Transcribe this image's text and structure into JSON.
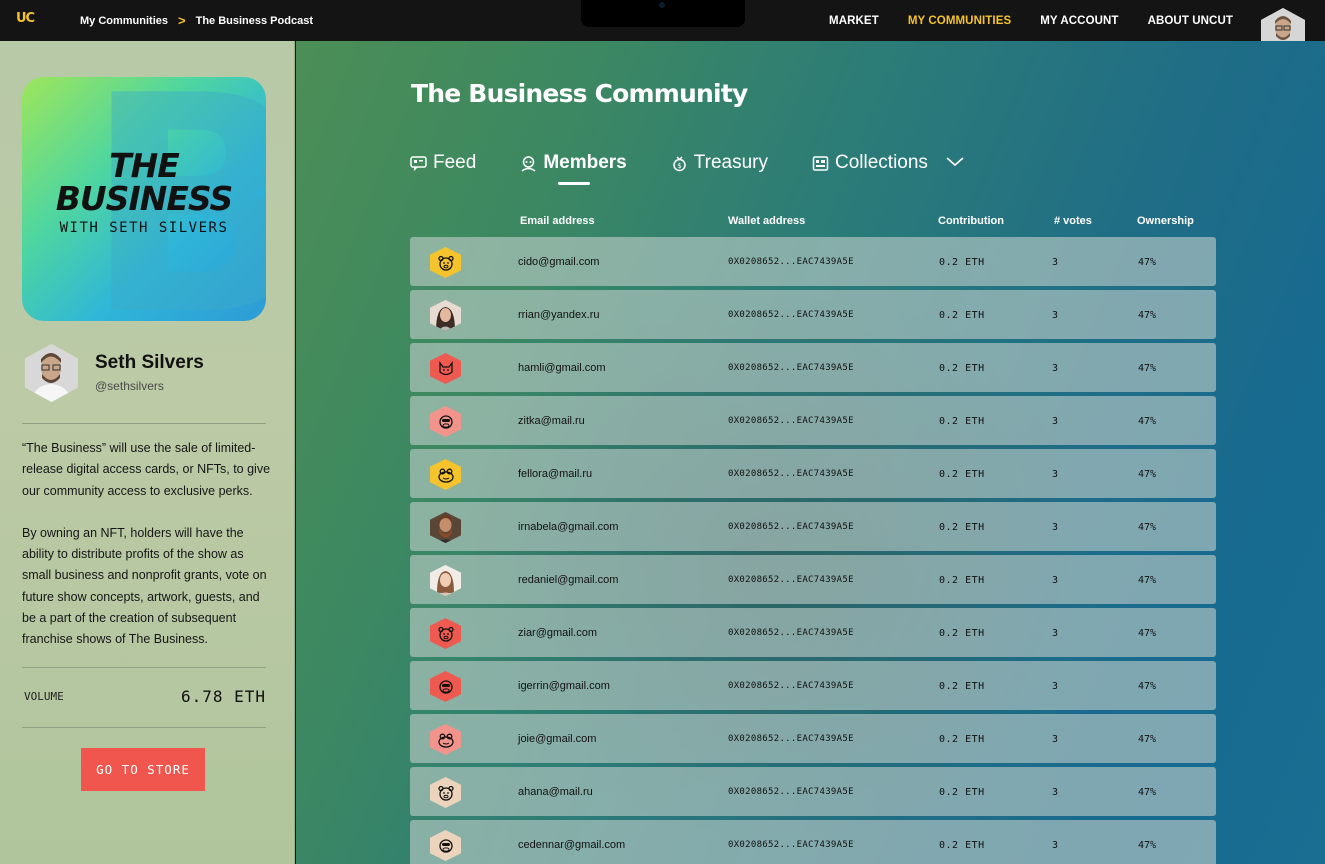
{
  "topbar": {
    "logo": "UC",
    "breadcrumb": [
      "My Communities",
      "The Business Podcast"
    ],
    "breadcrumb_separator": ">",
    "nav": [
      {
        "label": "MARKET",
        "active": false
      },
      {
        "label": "MY COMMUNITIES",
        "active": true
      },
      {
        "label": "MY ACCOUNT",
        "active": false
      },
      {
        "label": "ABOUT UNCUT",
        "active": false
      }
    ],
    "accent_color": "#f5c32c"
  },
  "sidebar": {
    "cover": {
      "line1": "THE",
      "line2": "BUSINESS",
      "line3": "WITH SETH SILVERS",
      "watermark": "B"
    },
    "host": {
      "name": "Seth Silvers",
      "handle": "@sethsilvers"
    },
    "description": [
      "“The Business” will use the sale of limited-release digital access cards, or NFTs, to give our community access to exclusive perks.",
      "By owning an NFT, holders will have the ability to distribute profits of the show as small business and nonprofit grants, vote on future show concepts, artwork, guests, and be a part of the creation of subsequent franchise shows of The Business."
    ],
    "volume_label": "VOLUME",
    "volume_value": "6.78 ETH",
    "store_button": "GO TO STORE",
    "store_button_color": "#f0564d"
  },
  "main": {
    "title": "The Business Community",
    "tabs": [
      {
        "label": "Feed",
        "icon": "feed-icon",
        "active": false
      },
      {
        "label": "Members",
        "icon": "members-icon",
        "active": true
      },
      {
        "label": "Treasury",
        "icon": "treasury-icon",
        "active": false
      },
      {
        "label": "Collections",
        "icon": "collections-icon",
        "active": false
      }
    ],
    "columns": [
      "Email address",
      "Wallet address",
      "Contribution",
      "# votes",
      "Ownership"
    ],
    "members": [
      {
        "email": "cido@gmail.com",
        "wallet": "0X0208652...EAC7439A5E",
        "contribution": "0.2 ETH",
        "votes": "3",
        "ownership": "47%",
        "avatar": "bear-icon",
        "avatar_color": "#f5c32c"
      },
      {
        "email": "rrian@yandex.ru",
        "wallet": "0X0208652...EAC7439A5E",
        "contribution": "0.2 ETH",
        "votes": "3",
        "ownership": "47%",
        "avatar": "photo-woman",
        "avatar_color": "#d8b9a8"
      },
      {
        "email": "hamli@gmail.com",
        "wallet": "0X0208652...EAC7439A5E",
        "contribution": "0.2 ETH",
        "votes": "3",
        "ownership": "47%",
        "avatar": "cat-icon",
        "avatar_color": "#ee5a4f"
      },
      {
        "email": "zitka@mail.ru",
        "wallet": "0X0208652...EAC7439A5E",
        "contribution": "0.2 ETH",
        "votes": "3",
        "ownership": "47%",
        "avatar": "monkey-icon",
        "avatar_color": "#f2948c"
      },
      {
        "email": "fellora@mail.ru",
        "wallet": "0X0208652...EAC7439A5E",
        "contribution": "0.2 ETH",
        "votes": "3",
        "ownership": "47%",
        "avatar": "frog-icon",
        "avatar_color": "#f5c32c"
      },
      {
        "email": "irnabela@gmail.com",
        "wallet": "0X0208652...EAC7439A5E",
        "contribution": "0.2 ETH",
        "votes": "3",
        "ownership": "47%",
        "avatar": "photo-man",
        "avatar_color": "#8a5a3c"
      },
      {
        "email": "redaniel@gmail.com",
        "wallet": "0X0208652...EAC7439A5E",
        "contribution": "0.2 ETH",
        "votes": "3",
        "ownership": "47%",
        "avatar": "photo-woman-2",
        "avatar_color": "#e3cbb5"
      },
      {
        "email": "ziar@gmail.com",
        "wallet": "0X0208652...EAC7439A5E",
        "contribution": "0.2 ETH",
        "votes": "3",
        "ownership": "47%",
        "avatar": "bear-icon",
        "avatar_color": "#ee5a4f"
      },
      {
        "email": "igerrin@gmail.com",
        "wallet": "0X0208652...EAC7439A5E",
        "contribution": "0.2 ETH",
        "votes": "3",
        "ownership": "47%",
        "avatar": "monkey-icon",
        "avatar_color": "#ee5a4f"
      },
      {
        "email": "joie@gmail.com",
        "wallet": "0X0208652...EAC7439A5E",
        "contribution": "0.2 ETH",
        "votes": "3",
        "ownership": "47%",
        "avatar": "frog-icon",
        "avatar_color": "#f2948c"
      },
      {
        "email": "ahana@mail.ru",
        "wallet": "0X0208652...EAC7439A5E",
        "contribution": "0.2 ETH",
        "votes": "3",
        "ownership": "47%",
        "avatar": "bear-icon",
        "avatar_color": "#ecd3bb"
      },
      {
        "email": "cedennar@gmail.com",
        "wallet": "0X0208652...EAC7439A5E",
        "contribution": "0.2 ETH",
        "votes": "3",
        "ownership": "47%",
        "avatar": "monkey-icon",
        "avatar_color": "#ecd3bb"
      }
    ]
  }
}
